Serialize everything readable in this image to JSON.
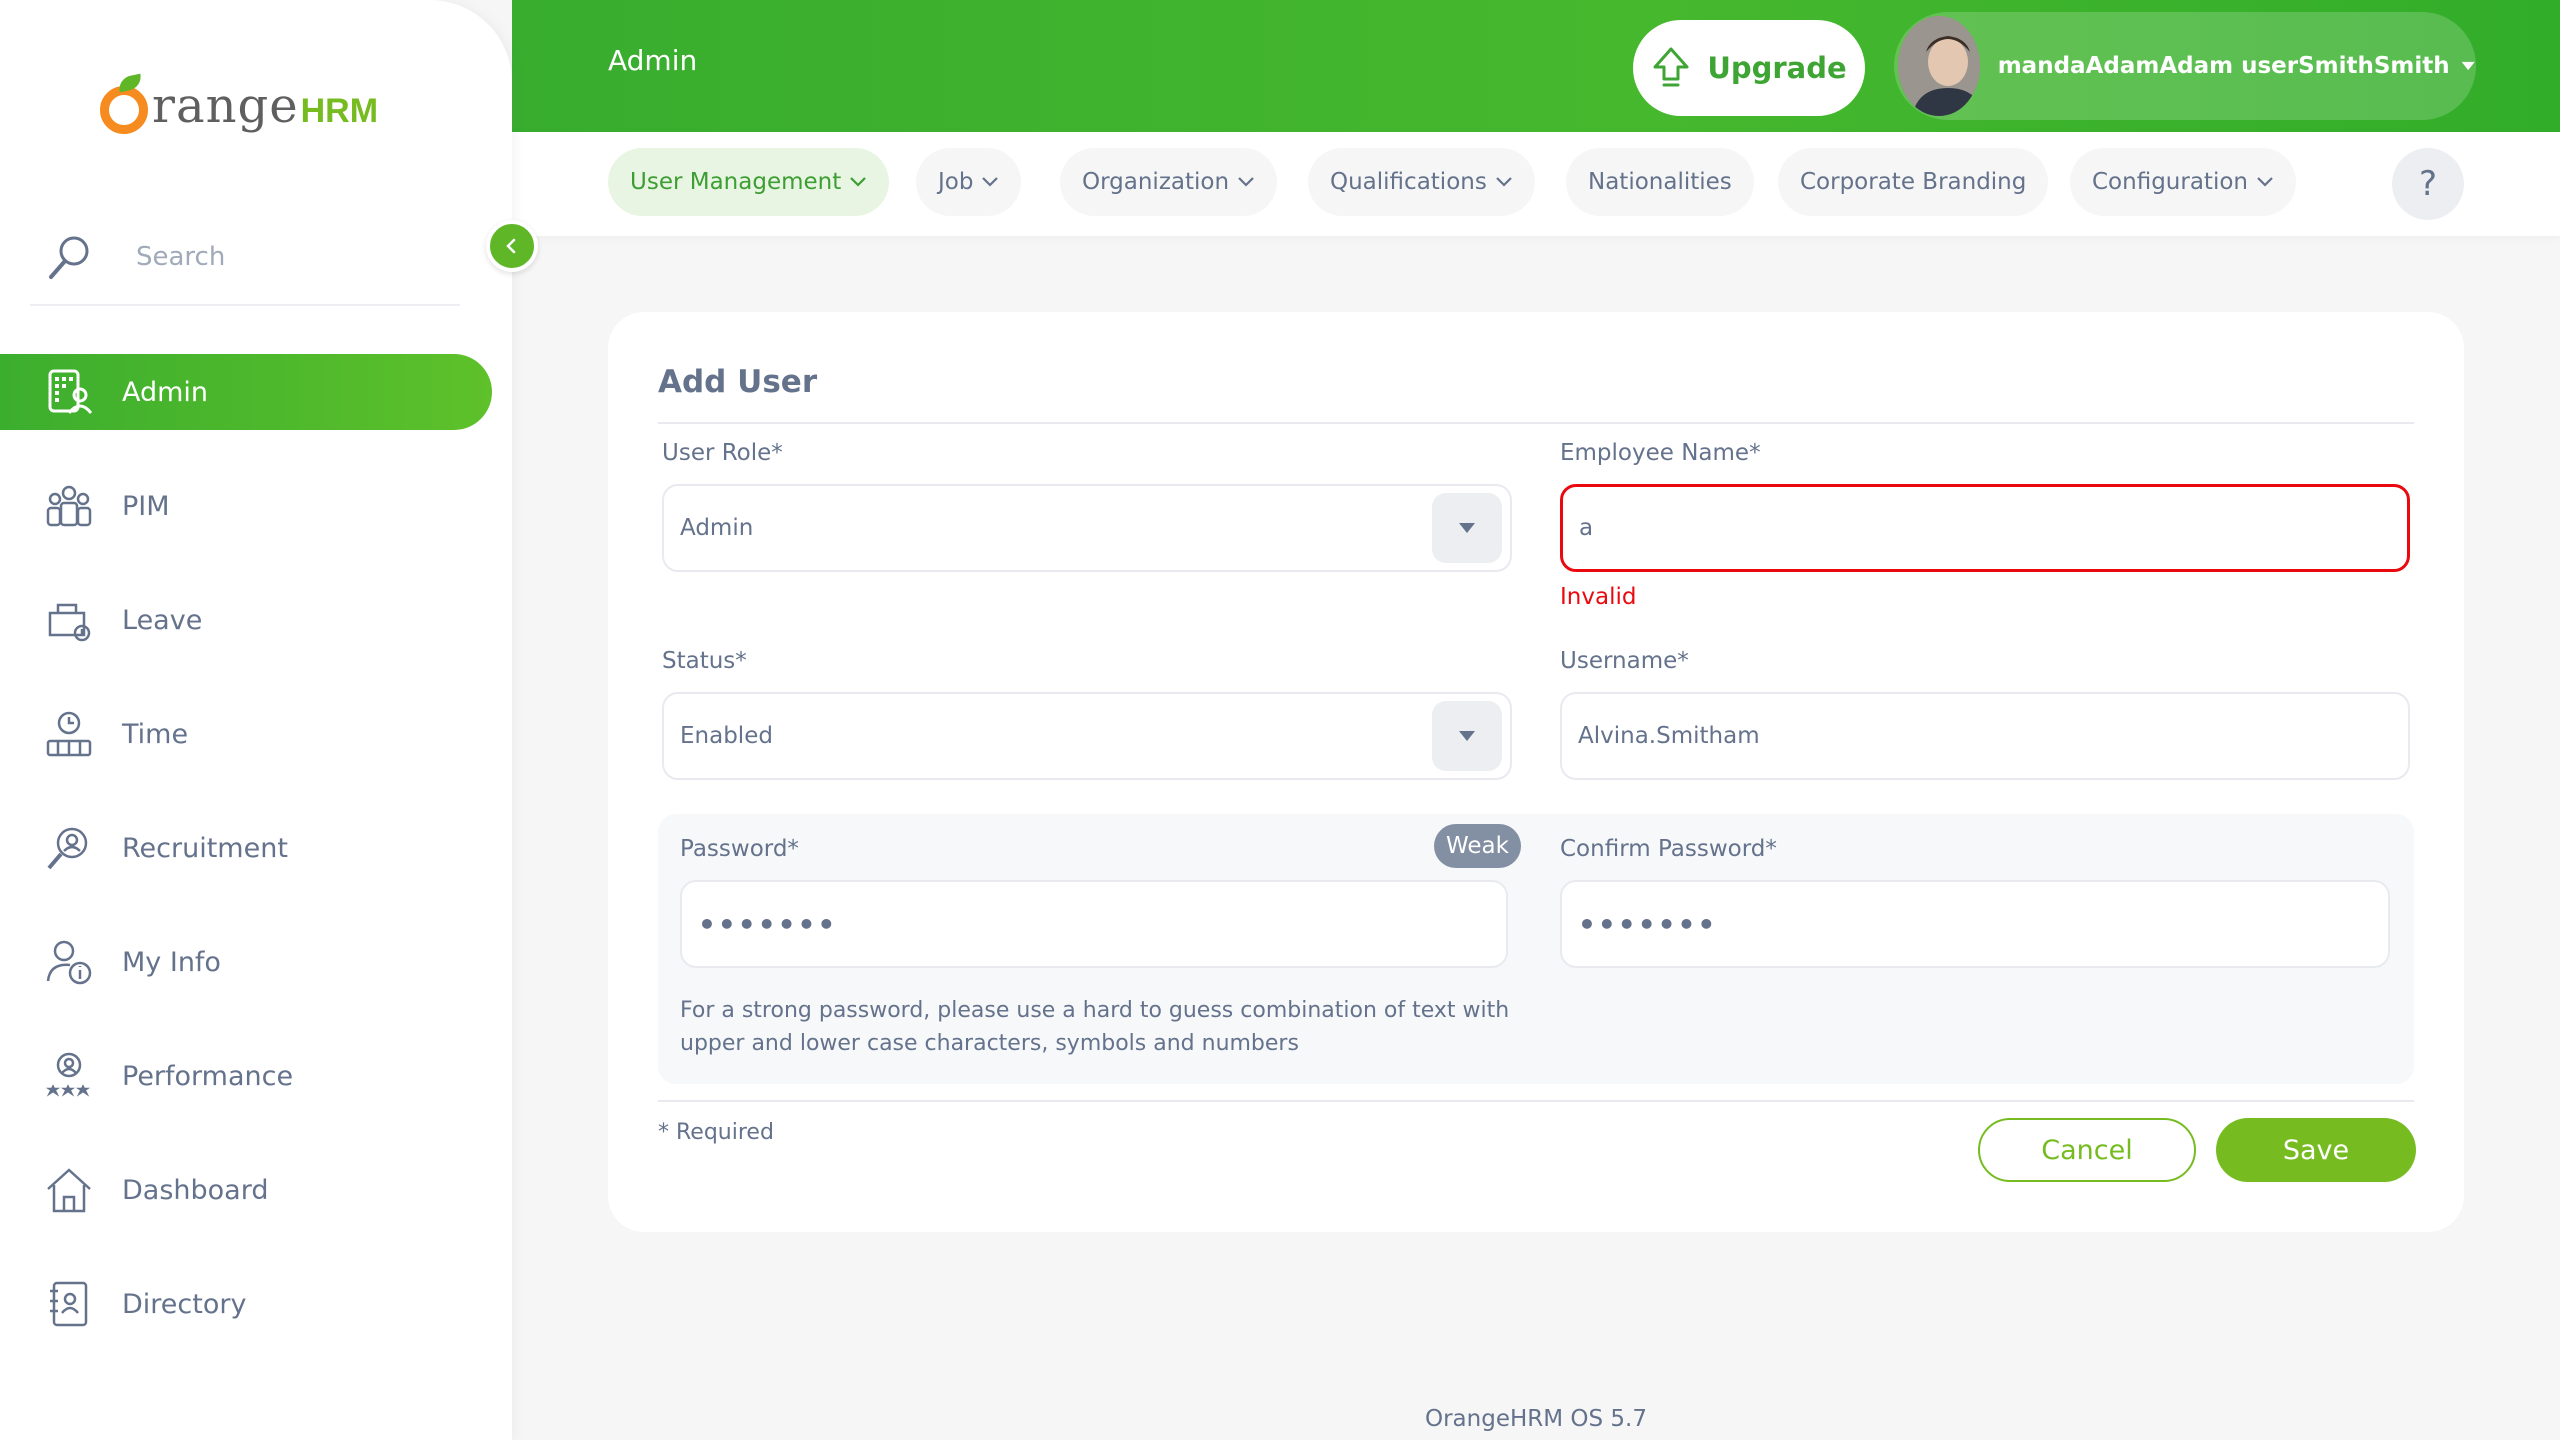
{
  "brand": {
    "word": "range",
    "suffix": "HRM",
    "colors": {
      "orange": "#f68c1f",
      "green": "#76bc21"
    }
  },
  "sidebar": {
    "search": {
      "placeholder": "Search",
      "icon": "search-icon"
    },
    "items": [
      {
        "label": "Admin",
        "icon": "admin-icon",
        "active": true
      },
      {
        "label": "PIM",
        "icon": "pim-icon"
      },
      {
        "label": "Leave",
        "icon": "leave-icon"
      },
      {
        "label": "Time",
        "icon": "time-icon"
      },
      {
        "label": "Recruitment",
        "icon": "recruitment-icon"
      },
      {
        "label": "My Info",
        "icon": "my-info-icon"
      },
      {
        "label": "Performance",
        "icon": "performance-icon"
      },
      {
        "label": "Dashboard",
        "icon": "dashboard-icon"
      },
      {
        "label": "Directory",
        "icon": "directory-icon"
      }
    ]
  },
  "topbar": {
    "title": "Admin",
    "upgrade_label": "Upgrade",
    "user_name": "mandaAdamAdam userSmithSmith"
  },
  "subnav": {
    "tabs": [
      {
        "label": "User Management",
        "dropdown": true,
        "active": true
      },
      {
        "label": "Job",
        "dropdown": true
      },
      {
        "label": "Organization",
        "dropdown": true
      },
      {
        "label": "Qualifications",
        "dropdown": true
      },
      {
        "label": "Nationalities",
        "dropdown": false
      },
      {
        "label": "Corporate Branding",
        "dropdown": false
      },
      {
        "label": "Configuration",
        "dropdown": true
      }
    ],
    "help_label": "?"
  },
  "form": {
    "title": "Add User",
    "user_role": {
      "label": "User Role*",
      "value": "Admin"
    },
    "employee_name": {
      "label": "Employee Name*",
      "value": "a",
      "error": "Invalid"
    },
    "status": {
      "label": "Status*",
      "value": "Enabled"
    },
    "username": {
      "label": "Username*",
      "value": "Alvina.Smitham"
    },
    "password": {
      "label": "Password*",
      "value": "•••••••",
      "strength": "Weak"
    },
    "confirm_password": {
      "label": "Confirm Password*",
      "value": "•••••••"
    },
    "hint_line1": "For a strong password, please use a hard to guess combination of text with",
    "hint_line2": "upper and lower case characters, symbols and numbers",
    "required_note": "* Required",
    "cancel_label": "Cancel",
    "save_label": "Save"
  },
  "footer": {
    "version": "OrangeHRM OS 5.7"
  },
  "colors": {
    "accent": "#76bc21",
    "topbar": "#46b82e",
    "error": "#eb0910",
    "text": "#64728c"
  }
}
